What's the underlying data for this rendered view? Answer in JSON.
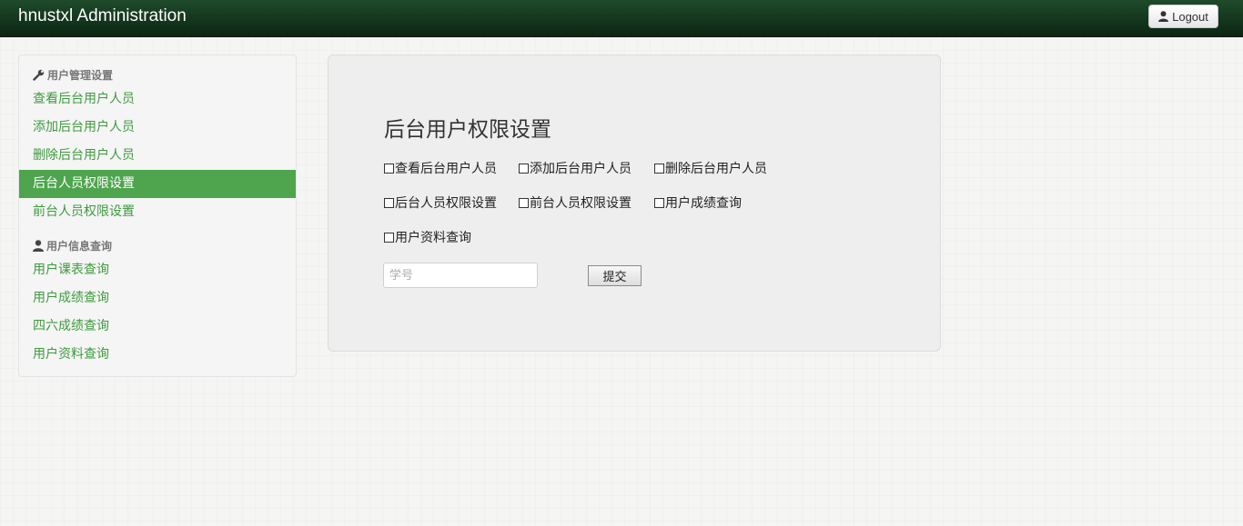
{
  "header": {
    "brand": "hnustxl Administration",
    "logout_label": "Logout"
  },
  "sidebar": {
    "sections": [
      {
        "header": "用户管理设置",
        "icon": "wrench-icon",
        "items": [
          {
            "label": "查看后台用户人员",
            "active": false
          },
          {
            "label": "添加后台用户人员",
            "active": false
          },
          {
            "label": "删除后台用户人员",
            "active": false
          },
          {
            "label": "后台人员权限设置",
            "active": true
          },
          {
            "label": "前台人员权限设置",
            "active": false
          }
        ]
      },
      {
        "header": "用户信息查询",
        "icon": "user-icon",
        "items": [
          {
            "label": "用户课表查询",
            "active": false
          },
          {
            "label": "用户成绩查询",
            "active": false
          },
          {
            "label": "四六成绩查询",
            "active": false
          },
          {
            "label": "用户资料查询",
            "active": false
          }
        ]
      }
    ]
  },
  "main": {
    "title": "后台用户权限设置",
    "permissions": [
      {
        "label": "查看后台用户人员",
        "checked": false
      },
      {
        "label": "添加后台用户人员",
        "checked": false
      },
      {
        "label": "删除后台用户人员",
        "checked": false
      },
      {
        "label": "后台人员权限设置",
        "checked": false
      },
      {
        "label": "前台人员权限设置",
        "checked": false
      },
      {
        "label": "用户成绩查询",
        "checked": false
      },
      {
        "label": "用户资料查询",
        "checked": false
      }
    ],
    "student_id": {
      "placeholder": "学号",
      "value": ""
    },
    "submit_label": "提交"
  },
  "colors": {
    "navbar": "#0b2613",
    "link": "#3e9a3e",
    "active_bg": "#4ea54e",
    "panel_bg": "#eeeeee"
  }
}
